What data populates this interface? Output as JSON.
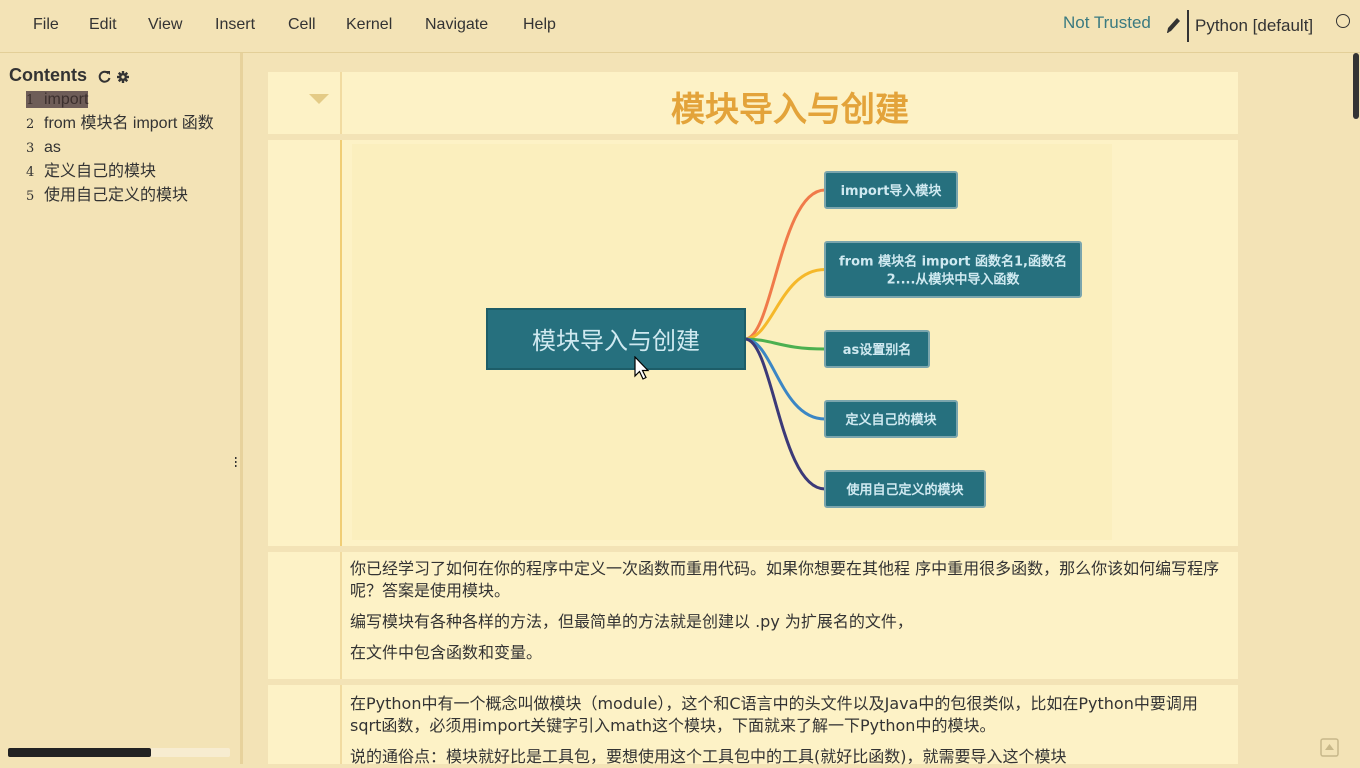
{
  "menubar": {
    "items": [
      "File",
      "Edit",
      "View",
      "Insert",
      "Cell",
      "Kernel",
      "Navigate",
      "Help"
    ],
    "trust_status": "Not Trusted",
    "kernel_name": "Python [default]"
  },
  "toc": {
    "header": "Contents",
    "items": [
      {
        "num": "1",
        "label": "import"
      },
      {
        "num": "2",
        "label": "from 模块名 import 函数"
      },
      {
        "num": "3",
        "label": "as"
      },
      {
        "num": "4",
        "label": "定义自己的模块"
      },
      {
        "num": "5",
        "label": "使用自己定义的模块"
      }
    ]
  },
  "cells": {
    "heading": "模块导入与创建",
    "mindmap": {
      "root": "模块导入与创建",
      "branches": [
        {
          "lines": [
            "import导入模块"
          ],
          "color": "#f07a4a"
        },
        {
          "lines": [
            "from 模块名 import 函数名1,函数名",
            "2....从模块中导入函数"
          ],
          "color": "#f5b82a"
        },
        {
          "lines": [
            "as设置别名"
          ],
          "color": "#4cb050"
        },
        {
          "lines": [
            "定义自己的模块"
          ],
          "color": "#3b86c4"
        },
        {
          "lines": [
            "使用自己定义的模块"
          ],
          "color": "#3c3a78"
        }
      ]
    },
    "text1": [
      "你已经学习了如何在你的程序中定义一次函数而重用代码。如果你想要在其他程 序中重用很多函数，那么你该如何编写程序呢？答案是使用模块。",
      "编写模块有各种各样的方法，但最简单的方法就是创建以 .py 为扩展名的文件，",
      "在文件中包含函数和变量。"
    ],
    "text2": [
      "在Python中有一个概念叫做模块（module），这个和C语言中的头文件以及Java中的包很类似，比如在Python中要调用sqrt函数，必须用import关键字引入math这个模块，下面就来了解一下Python中的模块。",
      "说的通俗点：模块就好比是工具包，要想使用这个工具包中的工具(就好比函数)，就需要导入这个模块"
    ]
  },
  "colors": {
    "background": "#f3e3b6",
    "cell_bg": "#fdf2c6",
    "heading": "#e3a33a",
    "node_fill": "#26707e",
    "node_text": "#cfe9f0"
  }
}
